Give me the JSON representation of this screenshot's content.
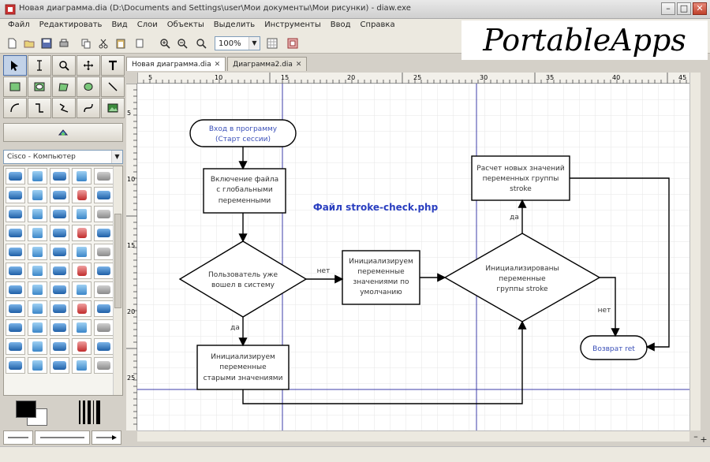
{
  "window": {
    "title": "Новая диаграмма.dia (D:\\Documents and Settings\\user\\Мои документы\\Мои рисунки) - diaw.exe"
  },
  "menu": [
    "Файл",
    "Редактировать",
    "Вид",
    "Слои",
    "Объекты",
    "Выделить",
    "Инструменты",
    "Ввод",
    "Справка"
  ],
  "toolbar": {
    "zoom_value": "100%"
  },
  "watermark": "PortableApps",
  "tabs": [
    {
      "label": "Новая диаграмма.dia",
      "active": true
    },
    {
      "label": "Диаграмма2.dia",
      "active": false
    }
  ],
  "sheet": "Cisco - Компьютер",
  "ruler": {
    "h_ticks": [
      "5",
      "10",
      "15",
      "20",
      "25",
      "30",
      "35",
      "40",
      "45"
    ],
    "v_ticks": [
      "5",
      "10",
      "15",
      "20",
      "25"
    ]
  },
  "diagram": {
    "start": [
      "Вход в программу",
      "(Старт сессии)"
    ],
    "include": [
      "Включение файла",
      "с глобальными",
      "переменными"
    ],
    "decision1": [
      "Пользователь уже",
      "вошел в систему"
    ],
    "init_defaults": [
      "Инициализируем",
      "переменные",
      "значениями по",
      "умолчанию"
    ],
    "init_stored": [
      "Инициализируем",
      "переменные",
      "старыми значениями"
    ],
    "decision2": [
      "Инициализированы",
      "переменные",
      "группы stroke"
    ],
    "calc": [
      "Расчет новых значений",
      "переменных группы",
      "stroke"
    ],
    "return": "Возврат ret",
    "float_label": "Файл stroke-check.php",
    "yes": "да",
    "no": "нет"
  }
}
